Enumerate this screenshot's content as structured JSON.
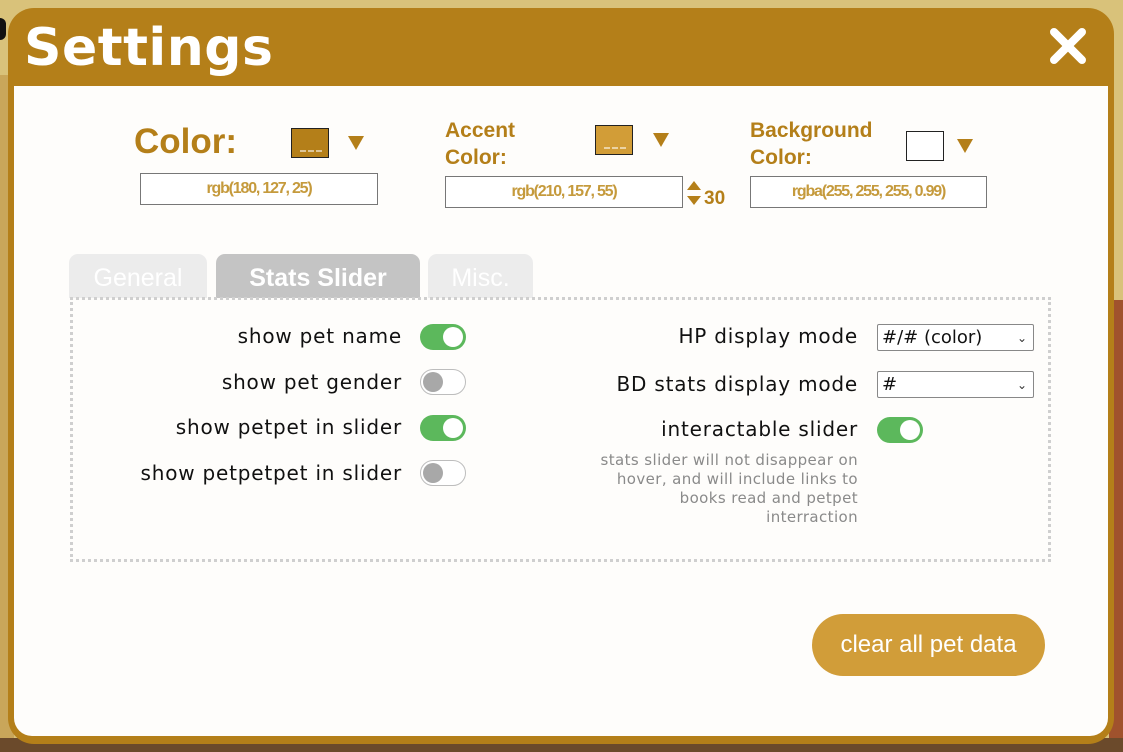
{
  "window": {
    "title": "Settings",
    "close_icon": "close-icon"
  },
  "colors": {
    "primary": {
      "label": "Color:",
      "swatch_color": "#b47f19",
      "value": "rgb(180, 127, 25)"
    },
    "accent": {
      "label_line1": "Accent",
      "label_line2": "Color:",
      "swatch_color": "#d29d37",
      "value": "rgb(210, 157, 55)",
      "stepper_value": "30"
    },
    "background": {
      "label_line1": "Background",
      "label_line2": "Color:",
      "swatch_color": "#ffffff",
      "value": "rgba(255, 255, 255, 0.99)"
    }
  },
  "tabs": [
    {
      "label": "General",
      "active": false
    },
    {
      "label": "Stats Slider",
      "active": true
    },
    {
      "label": "Misc.",
      "active": false
    }
  ],
  "stats_slider": {
    "toggles": [
      {
        "label": "show pet name",
        "on": true
      },
      {
        "label": "show pet gender",
        "on": false
      },
      {
        "label": "show petpet in slider",
        "on": true
      },
      {
        "label": "show petpetpet in slider",
        "on": false
      }
    ],
    "hp_display_mode": {
      "label": "HP display mode",
      "selected": "#/# (color)"
    },
    "bd_stats_display_mode": {
      "label": "BD stats display mode",
      "selected": "#"
    },
    "interactable_slider": {
      "label": "interactable slider",
      "on": true,
      "hint_lines": [
        "stats slider will not disappear on",
        "hover, and will include links to",
        "books read and petpet",
        "interraction"
      ]
    }
  },
  "actions": {
    "clear_label": "clear all pet data"
  }
}
